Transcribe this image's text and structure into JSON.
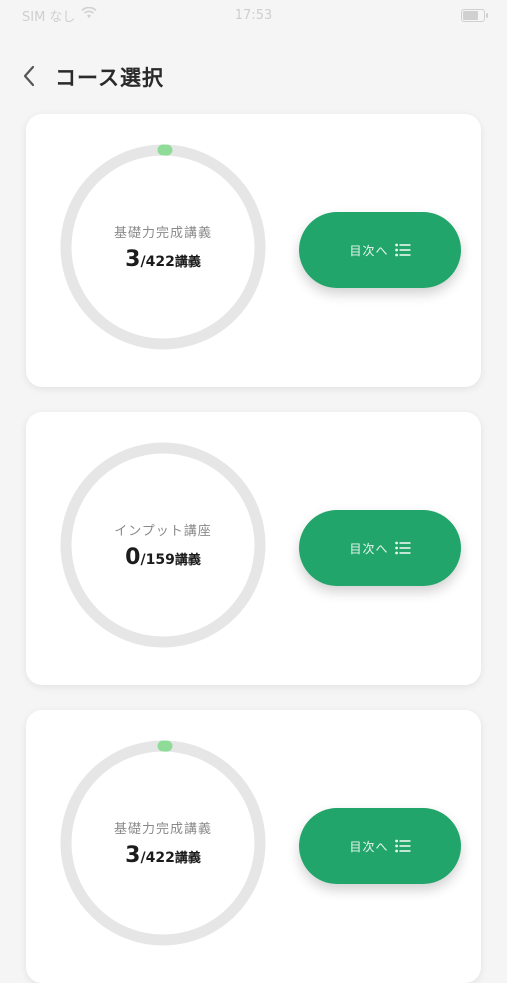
{
  "status_bar": {
    "carrier": "SIM なし",
    "time": "17:53"
  },
  "header": {
    "title": "コース選択"
  },
  "cards": [
    {
      "course_name": "基礎力完成講義",
      "progress_current": "3",
      "progress_total": "/422",
      "progress_unit": "講義",
      "progress_fraction": 0.0071,
      "button_label": "目次へ"
    },
    {
      "course_name": "インプット講座",
      "progress_current": "0",
      "progress_total": "/159",
      "progress_unit": "講義",
      "progress_fraction": 0,
      "button_label": "目次へ"
    },
    {
      "course_name": "基礎力完成講義",
      "progress_current": "3",
      "progress_total": "/422",
      "progress_unit": "講義",
      "progress_fraction": 0.0071,
      "button_label": "目次へ"
    }
  ],
  "colors": {
    "accent": "#22a56b",
    "ring_track": "#e6e6e6",
    "ring_progress": "#8fdc98"
  }
}
